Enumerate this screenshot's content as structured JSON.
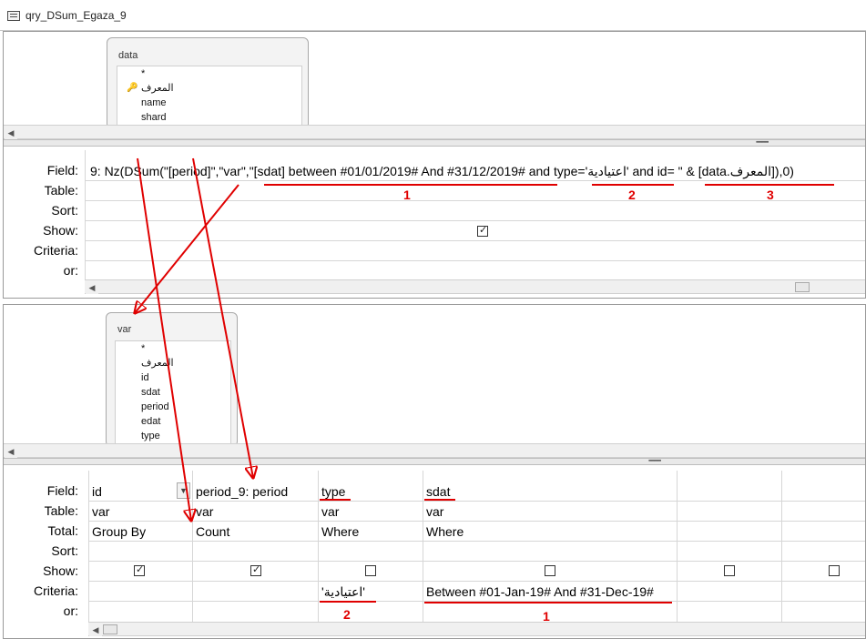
{
  "window": {
    "title": "qry_DSum_Egaza_9"
  },
  "upper_query": {
    "table": {
      "name": "data",
      "fields": [
        "*",
        "المعرف",
        "name",
        "shard"
      ]
    },
    "grid": {
      "row_labels": {
        "field": "Field:",
        "table": "Table:",
        "sort": "Sort:",
        "show": "Show:",
        "criteria": "Criteria:",
        "or": "or:"
      },
      "field_expr_a": "9: Nz(DSum(\"[period]\",\"var\",\"[sdat] between #01/01/2019# And #31/12/2019# and type='",
      "field_expr_b": "اعتيادية",
      "field_expr_c": "' and id= \" & [data.",
      "field_expr_d": "المعرف",
      "field_expr_e": "]),0)",
      "show_checked": true,
      "annotations": [
        "1",
        "2",
        "3"
      ]
    }
  },
  "lower_query": {
    "table": {
      "name": "var",
      "fields": [
        "*",
        "المعرف",
        "id",
        "sdat",
        "period",
        "edat",
        "type"
      ]
    },
    "grid": {
      "row_labels": {
        "field": "Field:",
        "table": "Table:",
        "total": "Total:",
        "sort": "Sort:",
        "show": "Show:",
        "criteria": "Criteria:",
        "or": "or:"
      },
      "columns": [
        {
          "field": "id",
          "table": "var",
          "total": "Group By",
          "show": true,
          "criteria": ""
        },
        {
          "field": "period_9: period",
          "table": "var",
          "total": "Count",
          "show": true,
          "criteria": ""
        },
        {
          "field": "type",
          "table": "var",
          "total": "Where",
          "show": false,
          "criteria": "'اعتيادية'"
        },
        {
          "field": "sdat",
          "table": "var",
          "total": "Where",
          "show": false,
          "criteria": "Between #01-Jan-19# And #31-Dec-19#"
        },
        {
          "field": "",
          "table": "",
          "total": "",
          "show": false,
          "criteria": ""
        },
        {
          "field": "",
          "table": "",
          "total": "",
          "show": false,
          "criteria": ""
        }
      ],
      "annotations": [
        "2",
        "1"
      ]
    }
  },
  "colors": {
    "annotation": "#e00000",
    "grid_line": "#d6d6d6"
  }
}
